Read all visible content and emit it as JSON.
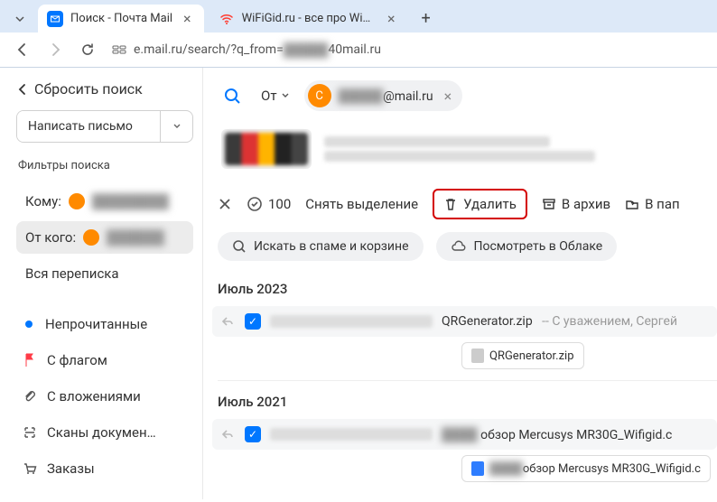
{
  "browser": {
    "tabs": [
      {
        "title": "Поиск - Почта Mail",
        "favicon": "mail"
      },
      {
        "title": "WiFiGid.ru - все про WiFi и бе",
        "favicon": "wifi"
      }
    ],
    "url_prefix": "e.mail.ru/search/?q_from=",
    "url_blur": "█████",
    "url_suffix": "40mail.ru"
  },
  "sidebar": {
    "reset": "Сбросить поиск",
    "compose": "Написать письмо",
    "filters_label": "Фильтры поиска",
    "filter_to": "Кому:",
    "filter_from": "От кого:",
    "filter_all": "Вся переписка",
    "items": [
      {
        "label": "Непрочитанные",
        "icon": "dot"
      },
      {
        "label": "С флагом",
        "icon": "flag"
      },
      {
        "label": "С вложениями",
        "icon": "clip"
      },
      {
        "label": "Сканы докумен…",
        "icon": "scan"
      },
      {
        "label": "Заказы",
        "icon": "cart"
      }
    ]
  },
  "search": {
    "from_label": "От",
    "chip_avatar": "C",
    "chip_email": "@mail.ru"
  },
  "toolbar": {
    "count": "100",
    "deselect": "Снять выделение",
    "delete": "Удалить",
    "archive": "В архив",
    "to_folder": "В пап"
  },
  "pills": {
    "spam": "Искать в спаме и корзине",
    "cloud": "Посмотреть в Облаке"
  },
  "groups": [
    {
      "header": "Июль 2023",
      "items": [
        {
          "subject": "QRGenerator.zip",
          "tail": "-- С уважением, Сергей",
          "attachment": "QRGenerator.zip",
          "att_icon": "file"
        }
      ]
    },
    {
      "header": "Июль 2021",
      "items": [
        {
          "subject_prefix": "█████",
          "subject": "обзор Mercusys MR30G_Wifigid.c",
          "attachment_prefix": "█████",
          "attachment": "обзор Mercusys MR30G_Wifigid.c",
          "att_icon": "w"
        }
      ]
    }
  ]
}
